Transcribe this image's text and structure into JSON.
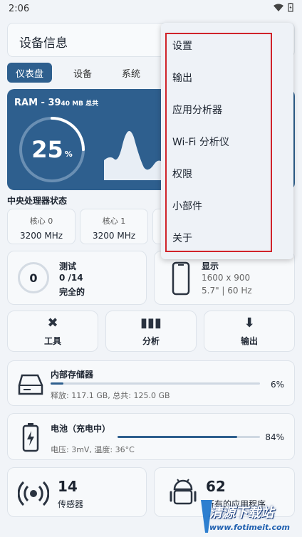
{
  "statusbar": {
    "time": "2:06"
  },
  "appbar": {
    "title": "设备信息"
  },
  "tabs": [
    {
      "label": "仪表盘"
    },
    {
      "label": "设备"
    },
    {
      "label": "系统"
    }
  ],
  "ram": {
    "prefix": "RAM - 39",
    "suffix": "40 MB 总共",
    "percent": "25",
    "unit": "%",
    "usage": 0.25
  },
  "cpu": {
    "title": "中央处理器状态",
    "cores": [
      {
        "name": "核心 0",
        "freq": "3200 MHz"
      },
      {
        "name": "核心 1",
        "freq": "3200 MHz"
      }
    ]
  },
  "tests": {
    "count": "0",
    "title": "测试",
    "progress": "0 /14",
    "status": "完全的"
  },
  "display": {
    "title": "显示",
    "resolution": "1600 x 900",
    "spec": "5.7\" | 60 Hz"
  },
  "actions": [
    {
      "label": "工具",
      "icon": "tools-icon"
    },
    {
      "label": "分析",
      "icon": "chart-icon"
    },
    {
      "label": "输出",
      "icon": "download-icon"
    }
  ],
  "storage": {
    "title": "内部存储器",
    "detail": "释放: 117.1 GB, 总共: 125.0 GB",
    "percent": "6%",
    "level": 0.06
  },
  "battery": {
    "title": "电池（充电中）",
    "detail": "电压: 3mV, 温度: 36°C",
    "percent": "84%",
    "level": 0.84
  },
  "sensors": {
    "count": "14",
    "label": "传感器"
  },
  "apps": {
    "count": "62",
    "label": "所有的应用程序"
  },
  "menu": {
    "items": [
      {
        "label": "设置"
      },
      {
        "label": "输出"
      },
      {
        "label": "应用分析器"
      },
      {
        "label": "Wi-Fi 分析仪"
      },
      {
        "label": "权限"
      },
      {
        "label": "小部件"
      },
      {
        "label": "关于"
      }
    ]
  },
  "watermark": {
    "text": "清源下载站",
    "url": "www.fotimeit.com"
  },
  "colors": {
    "primary": "#2e5f8e",
    "highlight": "#d0232a"
  }
}
